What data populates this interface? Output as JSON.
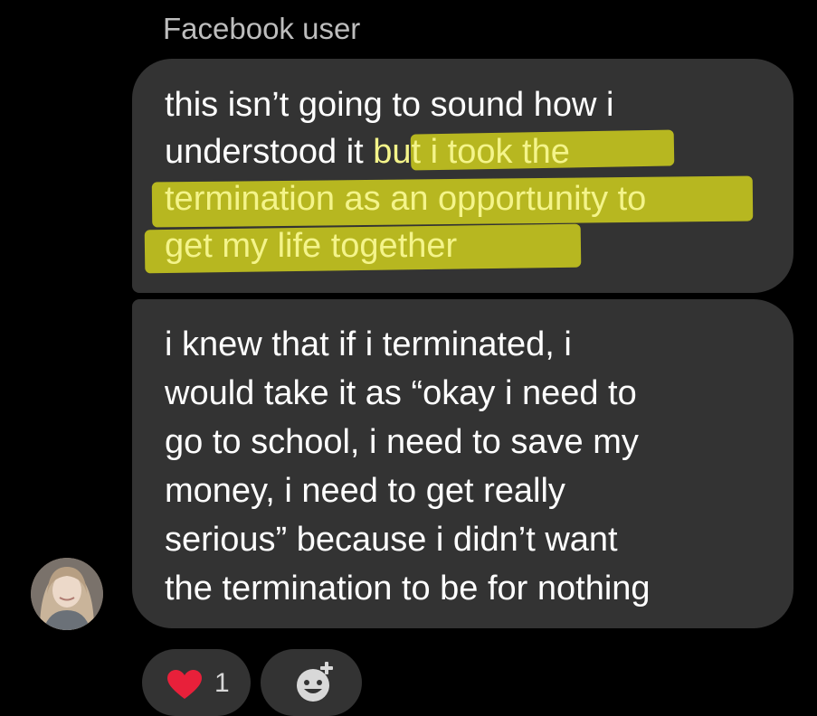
{
  "sender": {
    "name": "Facebook user"
  },
  "messages": [
    {
      "lines": [
        {
          "plain": "this isn’t going to sound how i"
        },
        {
          "plain": "understood it ",
          "highlighted": "but i took the"
        },
        {
          "highlighted": "termination as an opportunity to"
        },
        {
          "highlighted": "get my life together"
        }
      ]
    },
    {
      "lines": [
        "i knew that if i terminated, i",
        "would take it as “okay i need to",
        "go to school, i need to save my",
        "money, i need to get really",
        "serious” because i didn’t want",
        "the termination to be for nothing"
      ]
    }
  ],
  "reactions": {
    "heart_count": "1",
    "heart_icon": "heart-icon",
    "add_icon": "add-reaction-icon"
  },
  "colors": {
    "background": "#000000",
    "bubble": "#333333",
    "highlight": "#c9c91e",
    "heart": "#e8203a"
  }
}
